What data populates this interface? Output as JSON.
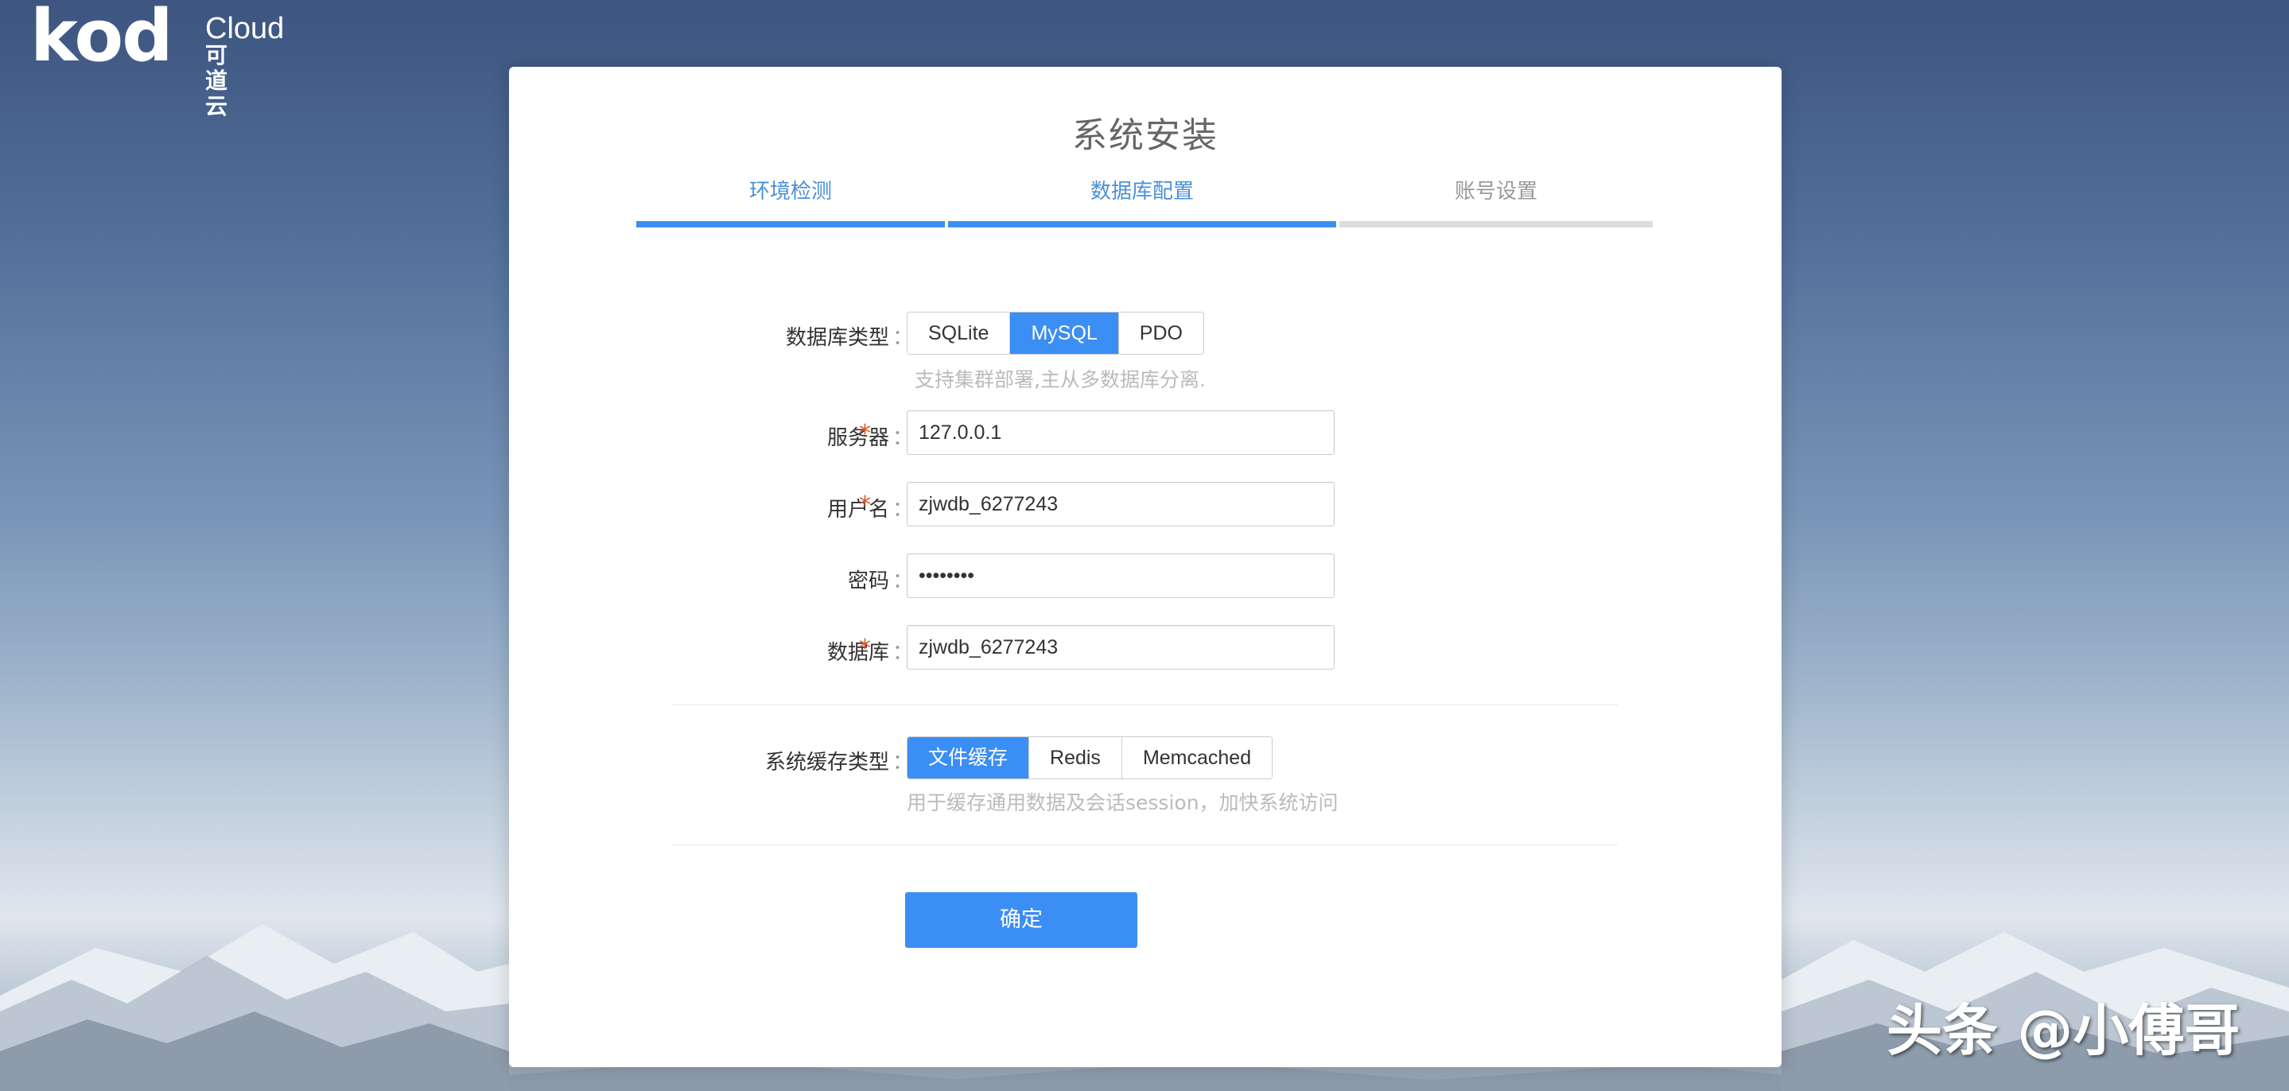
{
  "brand": {
    "wordmark": "kod",
    "cloud": "Cloud",
    "cn": "可道云"
  },
  "page": {
    "title": "系统安装"
  },
  "steps": [
    {
      "label": "环境检测",
      "state": "done"
    },
    {
      "label": "数据库配置",
      "state": "current"
    },
    {
      "label": "账号设置",
      "state": "pending"
    }
  ],
  "form": {
    "db_type": {
      "label": "数据库类型",
      "options": [
        "SQLite",
        "MySQL",
        "PDO"
      ],
      "selected": "MySQL",
      "hint": "支持集群部署,主从多数据库分离."
    },
    "server": {
      "label": "服务器",
      "value": "127.0.0.1",
      "required": true
    },
    "username": {
      "label": "用户名",
      "value": "zjwdb_6277243",
      "required": true
    },
    "password": {
      "label": "密码",
      "value": "••••••••",
      "required": false
    },
    "database": {
      "label": "数据库",
      "value": "zjwdb_6277243",
      "required": true
    },
    "cache_type": {
      "label": "系统缓存类型",
      "options": [
        "文件缓存",
        "Redis",
        "Memcached"
      ],
      "selected": "文件缓存",
      "hint": "用于缓存通用数据及会话session，加快系统访问"
    },
    "colon": "：",
    "required_mark": "*",
    "submit": "确定"
  },
  "watermark": "头条 @小傅哥",
  "colors": {
    "accent": "#3b8ef3",
    "required": "#e05a2a"
  }
}
